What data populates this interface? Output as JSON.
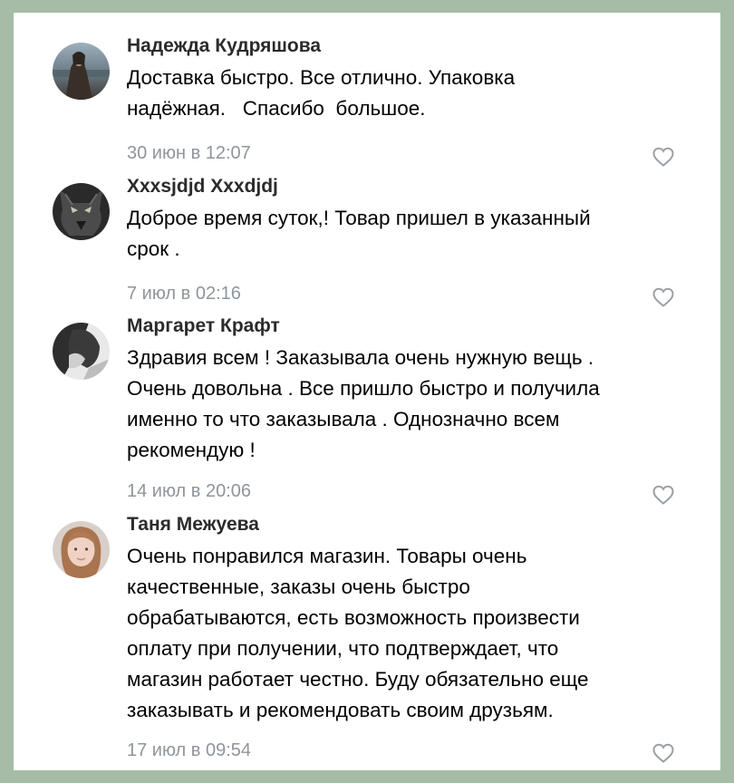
{
  "comments": [
    {
      "author": "Надежда Кудряшова",
      "text": "Доставка быстро. Все отлично. Упаковка\nнадёжная.   Спасибо  большое.",
      "time": "30 июн в 12:07",
      "avatar_icon": "avatar-photo-portrait"
    },
    {
      "author": "Xxxsjdjd Xxxdjdj",
      "text": "Доброе время суток,! Товар пришел в указанный\nсрок .",
      "time": "7 июл в 02:16",
      "avatar_icon": "avatar-photo-wolf"
    },
    {
      "author": "Маргарет Крафт",
      "text": "Здравия всем ! Заказывала очень нужную вещь .\nОчень довольна . Все пришло быстро и получила\nименно то что заказывала . Однозначно всем\nрекомендую !",
      "time": "14 июл в 20:06",
      "avatar_icon": "avatar-photo-dark"
    },
    {
      "author": "Таня Межуева",
      "text": "Очень понравился магазин. Товары очень\nкачественные, заказы очень быстро\nобрабатываются, есть возможность произвести\nоплату при получении, что подтверждает, что\nмагазин работает честно. Буду обязательно еще\nзаказывать и рекомендовать своим друзьям.",
      "time": "17 июл в 09:54",
      "avatar_icon": "avatar-photo-woman"
    }
  ],
  "like_icon": "heart-outline-icon",
  "colors": {
    "background": "#a6bca6",
    "card": "#ffffff",
    "author": "#2b2b2b",
    "text": "#000000",
    "time": "#8f959b",
    "icon": "#9aa0a6"
  }
}
